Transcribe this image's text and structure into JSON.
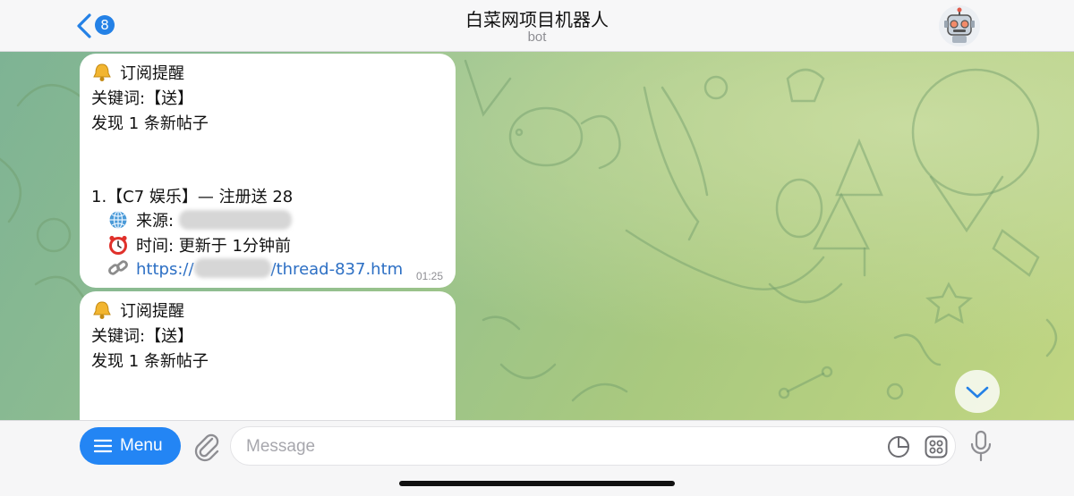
{
  "header": {
    "back_badge": "8",
    "title": "白菜网项目机器人",
    "subtitle": "bot",
    "avatar_icon": "robot-avatar-icon"
  },
  "messages": [
    {
      "title": "订阅提醒",
      "title_icon": "bell-icon",
      "keyword": "关键词:【送】",
      "found": "发现 1 条新帖子",
      "item_title": "1.【C7 娱乐】— 注册送 28",
      "source_label": "来源: ",
      "source_icon": "globe-icon",
      "time_label": "时间: 更新于 1分钟前",
      "time_icon": "alarm-clock-icon",
      "link_prefix": "https://",
      "link_suffix": "/thread-837.htm",
      "link_icon": "link-icon",
      "timestamp": "01:25"
    },
    {
      "title": "订阅提醒",
      "title_icon": "bell-icon",
      "keyword": "关键词:【送】",
      "found": "发现 1 条新帖子"
    }
  ],
  "composer": {
    "menu_label": "Menu",
    "placeholder": "Message",
    "value": ""
  },
  "colors": {
    "accent": "#2385f4",
    "link": "#2c6fc4",
    "chat_bg_start": "#7eb394",
    "chat_bg_end": "#c1d682"
  }
}
